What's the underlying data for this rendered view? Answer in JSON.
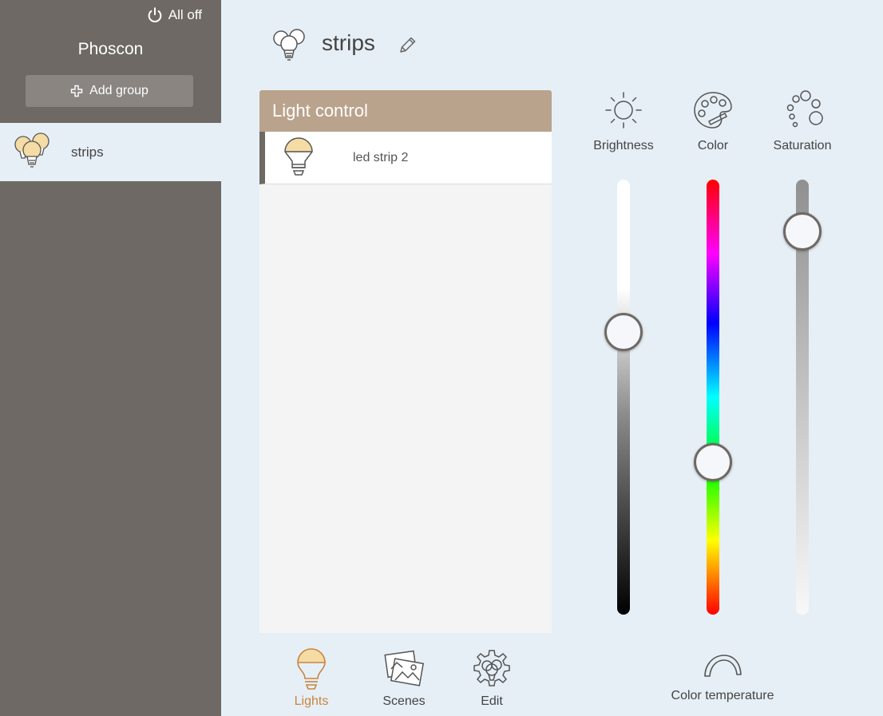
{
  "sidebar": {
    "all_off_label": "All off",
    "brand": "Phoscon",
    "add_group_label": "Add group",
    "groups": [
      {
        "label": "strips",
        "icon": "group-bulbs-icon",
        "selected": true
      }
    ]
  },
  "header": {
    "title": "strips",
    "icon": "group-bulbs-icon",
    "edit_icon": "pencil-icon"
  },
  "panel": {
    "title": "Light control",
    "lights": [
      {
        "label": "led strip 2",
        "icon": "bulb-icon"
      }
    ]
  },
  "tabs": [
    {
      "label": "Lights",
      "icon": "bulb-icon",
      "active": true
    },
    {
      "label": "Scenes",
      "icon": "scenes-icon",
      "active": false
    },
    {
      "label": "Edit",
      "icon": "gear-icon",
      "active": false
    }
  ],
  "controls": {
    "brightness": {
      "label": "Brightness",
      "icon": "sun-icon",
      "level": 0.35
    },
    "color": {
      "label": "Color",
      "icon": "palette-icon",
      "level": 0.65
    },
    "saturation": {
      "label": "Saturation",
      "icon": "dots-icon",
      "level": 0.12
    },
    "color_temperature": {
      "label": "Color temperature",
      "icon": "arc-icon"
    }
  },
  "colors": {
    "sidebar": "#6e6964",
    "panel_header": "#baa38c",
    "accent": "#c8853e",
    "background": "#e6eff6"
  }
}
